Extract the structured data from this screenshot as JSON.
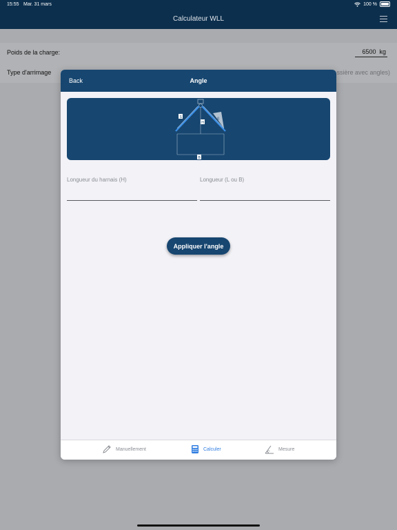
{
  "status": {
    "time": "15:55",
    "date": "Mar. 31 mars",
    "battery": "100 %"
  },
  "nav": {
    "title": "Calculateur WLL"
  },
  "background": {
    "load_label": "Poids de la charge:",
    "load_value": "6500",
    "load_unit": "kg",
    "type_label": "Type d'arrimage",
    "type_hint": "ssière avec angles)"
  },
  "modal": {
    "back_label": "Back",
    "title": "Angle",
    "diagram_labels": {
      "s": "S",
      "h": "H",
      "b": "B",
      "beta": "β"
    },
    "fields": [
      {
        "label": "Longueur du harnais (H)",
        "value": ""
      },
      {
        "label": "Longueur (L ou B)",
        "value": ""
      }
    ],
    "apply_label": "Appliquer l'angle"
  },
  "tabs": [
    {
      "label": "Manuellement",
      "icon": "pencil-icon",
      "active": false
    },
    {
      "label": "Calculer",
      "icon": "calculator-icon",
      "active": true
    },
    {
      "label": "Mesure",
      "icon": "ruler-angle-icon",
      "active": false
    }
  ],
  "colors": {
    "nav": "#0c2f4d",
    "modal_header": "#174670",
    "accent": "#2f7de1",
    "diagram_line": "#3a8ee6"
  }
}
